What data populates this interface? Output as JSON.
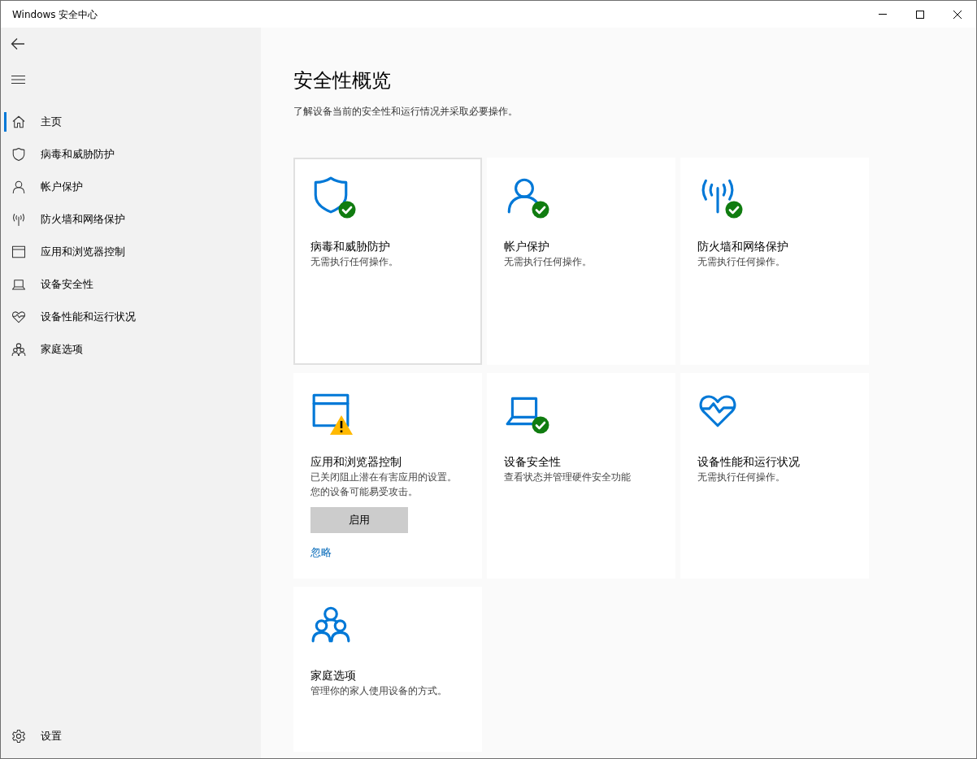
{
  "window": {
    "title": "Windows 安全中心"
  },
  "sidebar": {
    "items": [
      {
        "kind": "home",
        "label": "主页",
        "selected": true
      },
      {
        "kind": "shield",
        "label": "病毒和威胁防护",
        "selected": false
      },
      {
        "kind": "person",
        "label": "帐户保护",
        "selected": false
      },
      {
        "kind": "antenna",
        "label": "防火墙和网络保护",
        "selected": false
      },
      {
        "kind": "window",
        "label": "应用和浏览器控制",
        "selected": false
      },
      {
        "kind": "laptop",
        "label": "设备安全性",
        "selected": false
      },
      {
        "kind": "heart",
        "label": "设备性能和运行状况",
        "selected": false
      },
      {
        "kind": "family",
        "label": "家庭选项",
        "selected": false
      }
    ],
    "settings": {
      "label": "设置"
    }
  },
  "main": {
    "title": "安全性概览",
    "subtitle": "了解设备当前的安全性和运行情况并采取必要操作。",
    "cards": [
      {
        "kind": "shield",
        "checked": true,
        "warning": false,
        "title": "病毒和威胁防护",
        "description": "无需执行任何操作。",
        "selected": true
      },
      {
        "kind": "person",
        "checked": true,
        "warning": false,
        "title": "帐户保护",
        "description": "无需执行任何操作。",
        "selected": false
      },
      {
        "kind": "antenna",
        "checked": true,
        "warning": false,
        "title": "防火墙和网络保护",
        "description": "无需执行任何操作。",
        "selected": false
      },
      {
        "kind": "window",
        "checked": false,
        "warning": true,
        "title": "应用和浏览器控制",
        "description": "已关闭阻止潜在有害应用的设置。您的设备可能易受攻击。",
        "button": "启用",
        "link": "忽略",
        "selected": false
      },
      {
        "kind": "laptop",
        "checked": true,
        "warning": false,
        "title": "设备安全性",
        "description": "查看状态并管理硬件安全功能",
        "selected": false
      },
      {
        "kind": "heart",
        "checked": false,
        "warning": false,
        "title": "设备性能和运行状况",
        "description": "无需执行任何操作。",
        "selected": false
      },
      {
        "kind": "family",
        "checked": false,
        "warning": false,
        "title": "家庭选项",
        "description": "管理你的家人使用设备的方式。",
        "selected": false
      }
    ]
  }
}
